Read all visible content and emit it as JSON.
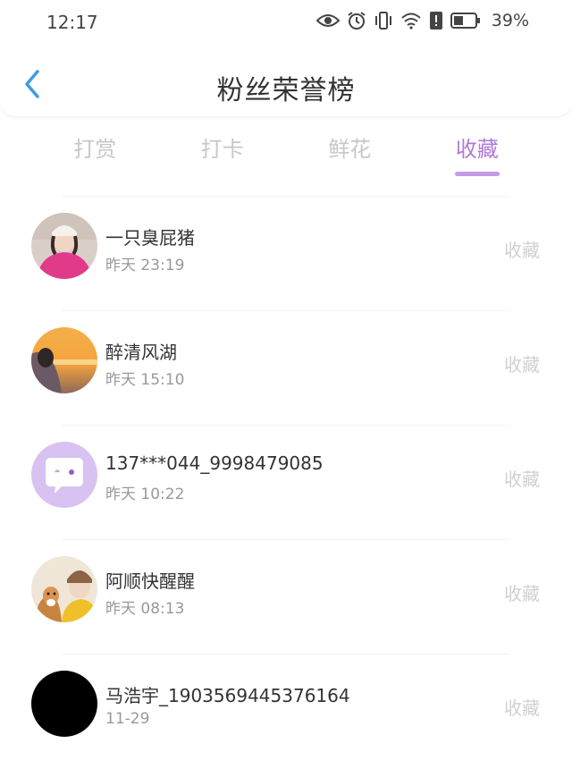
{
  "status_bar": {
    "time": "12:17",
    "battery": "39%",
    "icons": [
      "eye-icon",
      "alarm-icon",
      "vibrate-icon",
      "wifi-icon",
      "alert-icon",
      "battery-icon"
    ]
  },
  "header": {
    "title": "粉丝荣誉榜",
    "back_icon": "chevron-left-icon"
  },
  "tabs": [
    {
      "label": "打赏",
      "active": false
    },
    {
      "label": "打卡",
      "active": false
    },
    {
      "label": "鲜花",
      "active": false
    },
    {
      "label": "收藏",
      "active": true
    }
  ],
  "accent_color": "#b07bd8",
  "list": [
    {
      "name": "一只臭屁猪",
      "time": "昨天 23:19",
      "action": "收藏",
      "avatar": "girl-pink-shirt"
    },
    {
      "name": "醉清风湖",
      "time": "昨天 15:10",
      "action": "收藏",
      "avatar": "sunset-portrait"
    },
    {
      "name": "137***044_9998479085",
      "time": "昨天 10:22",
      "action": "收藏",
      "avatar": "default-chat-avatar"
    },
    {
      "name": "阿顺快醒醒",
      "time": "昨天 08:13",
      "action": "收藏",
      "avatar": "girl-with-dog"
    },
    {
      "name": "马浩宇_1903569445376164",
      "time": "11-29",
      "action": "收藏",
      "avatar": "black-avatar"
    }
  ]
}
